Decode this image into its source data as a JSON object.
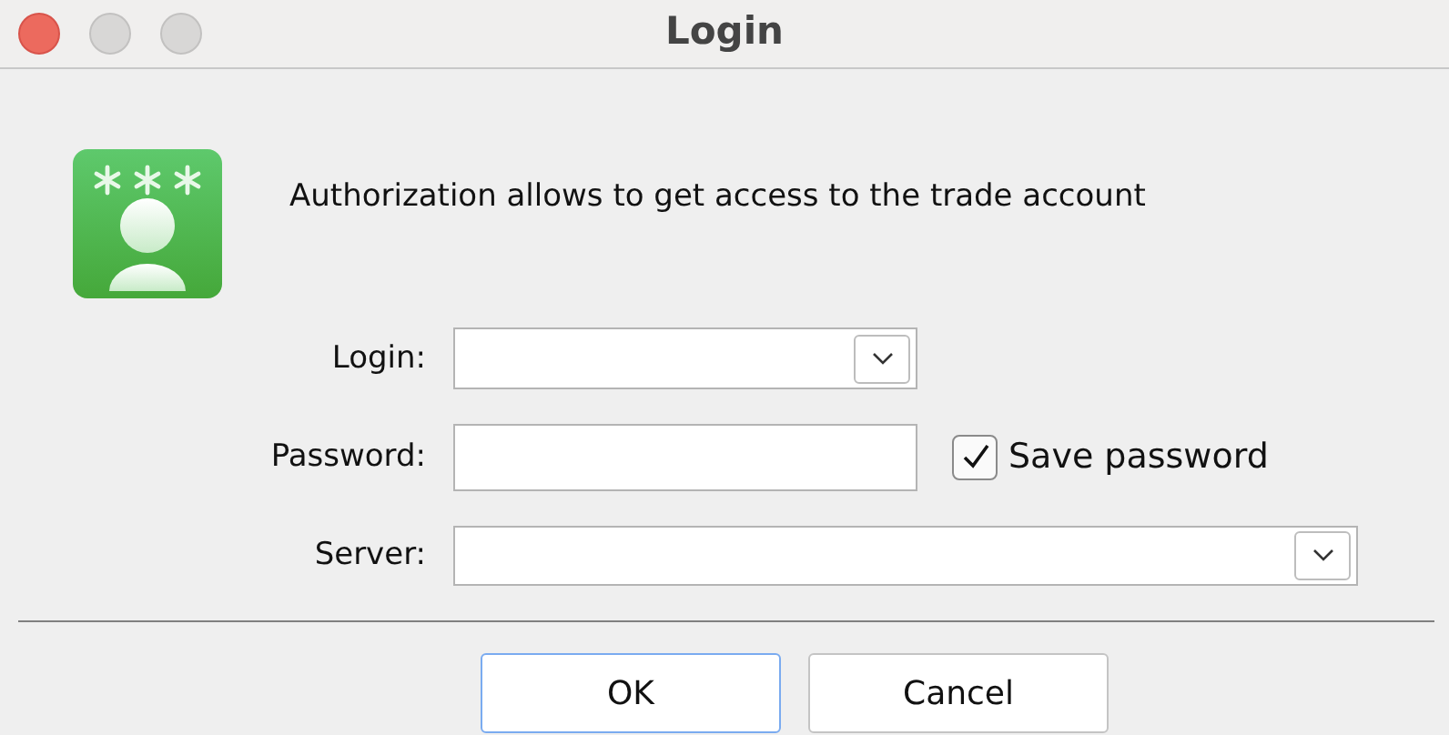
{
  "window": {
    "title": "Login"
  },
  "message": "Authorization allows to get access to the trade account",
  "fields": [
    {
      "label": "Login:",
      "kind": "combo",
      "wide": false
    },
    {
      "label": "Password:",
      "kind": "password",
      "wide": false,
      "option": {
        "label": "Save password",
        "checked": true
      }
    },
    {
      "label": "Server:",
      "kind": "combo",
      "wide": true
    }
  ],
  "buttons": [
    {
      "label": "OK",
      "default": true
    },
    {
      "label": "Cancel",
      "default": false
    }
  ]
}
